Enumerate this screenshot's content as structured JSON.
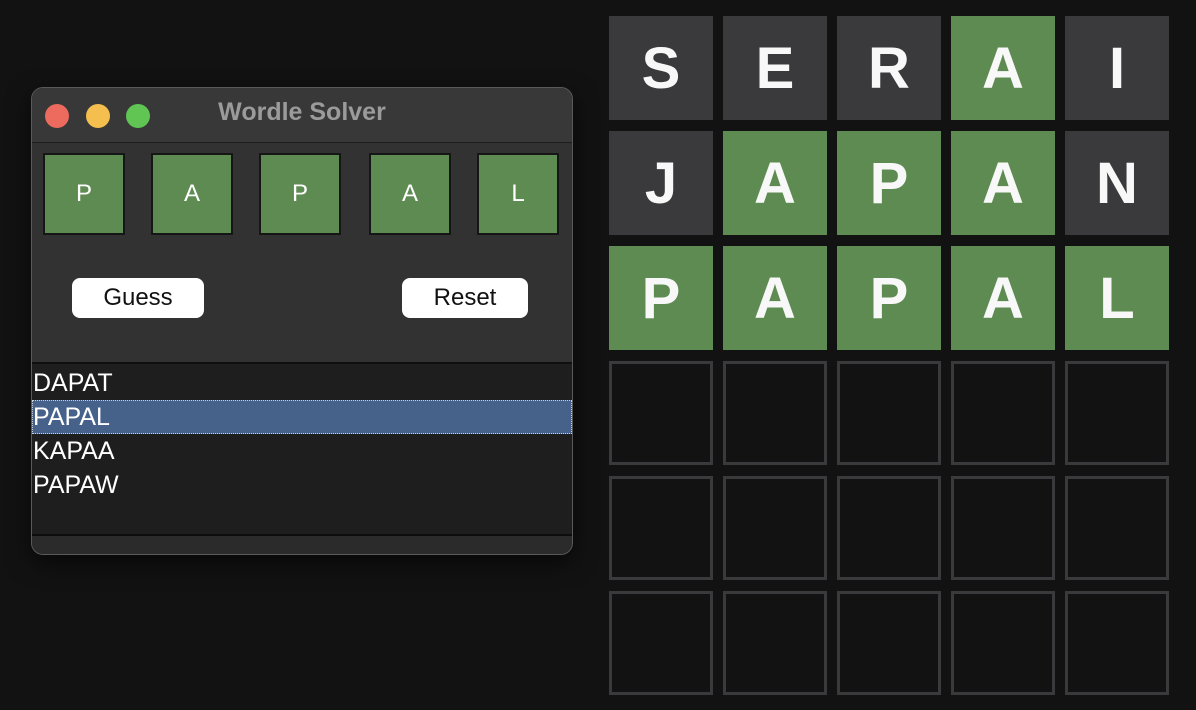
{
  "solver_window": {
    "title": "Wordle Solver",
    "input_tiles": [
      {
        "letter": "P",
        "state": "green"
      },
      {
        "letter": "A",
        "state": "green"
      },
      {
        "letter": "P",
        "state": "green"
      },
      {
        "letter": "A",
        "state": "green"
      },
      {
        "letter": "L",
        "state": "green"
      }
    ],
    "guess_label": "Guess",
    "reset_label": "Reset",
    "candidates": [
      "DAPAT",
      "PAPAL",
      "KAPAA",
      "PAPAW"
    ],
    "selected_candidate": "PAPAL"
  },
  "board": {
    "rows": [
      [
        {
          "letter": "S",
          "state": "gray"
        },
        {
          "letter": "E",
          "state": "gray"
        },
        {
          "letter": "R",
          "state": "gray"
        },
        {
          "letter": "A",
          "state": "green"
        },
        {
          "letter": "I",
          "state": "gray"
        }
      ],
      [
        {
          "letter": "J",
          "state": "gray"
        },
        {
          "letter": "A",
          "state": "green"
        },
        {
          "letter": "P",
          "state": "green"
        },
        {
          "letter": "A",
          "state": "green"
        },
        {
          "letter": "N",
          "state": "gray"
        }
      ],
      [
        {
          "letter": "P",
          "state": "green"
        },
        {
          "letter": "A",
          "state": "green"
        },
        {
          "letter": "P",
          "state": "green"
        },
        {
          "letter": "A",
          "state": "green"
        },
        {
          "letter": "L",
          "state": "green"
        }
      ],
      [
        {
          "letter": "",
          "state": "empty"
        },
        {
          "letter": "",
          "state": "empty"
        },
        {
          "letter": "",
          "state": "empty"
        },
        {
          "letter": "",
          "state": "empty"
        },
        {
          "letter": "",
          "state": "empty"
        }
      ],
      [
        {
          "letter": "",
          "state": "empty"
        },
        {
          "letter": "",
          "state": "empty"
        },
        {
          "letter": "",
          "state": "empty"
        },
        {
          "letter": "",
          "state": "empty"
        },
        {
          "letter": "",
          "state": "empty"
        }
      ],
      [
        {
          "letter": "",
          "state": "empty"
        },
        {
          "letter": "",
          "state": "empty"
        },
        {
          "letter": "",
          "state": "empty"
        },
        {
          "letter": "",
          "state": "empty"
        },
        {
          "letter": "",
          "state": "empty"
        }
      ]
    ]
  },
  "colors": {
    "background": "#121213",
    "correct": "#5e8b52",
    "absent": "#3a3a3c",
    "selection": "#46628b"
  }
}
